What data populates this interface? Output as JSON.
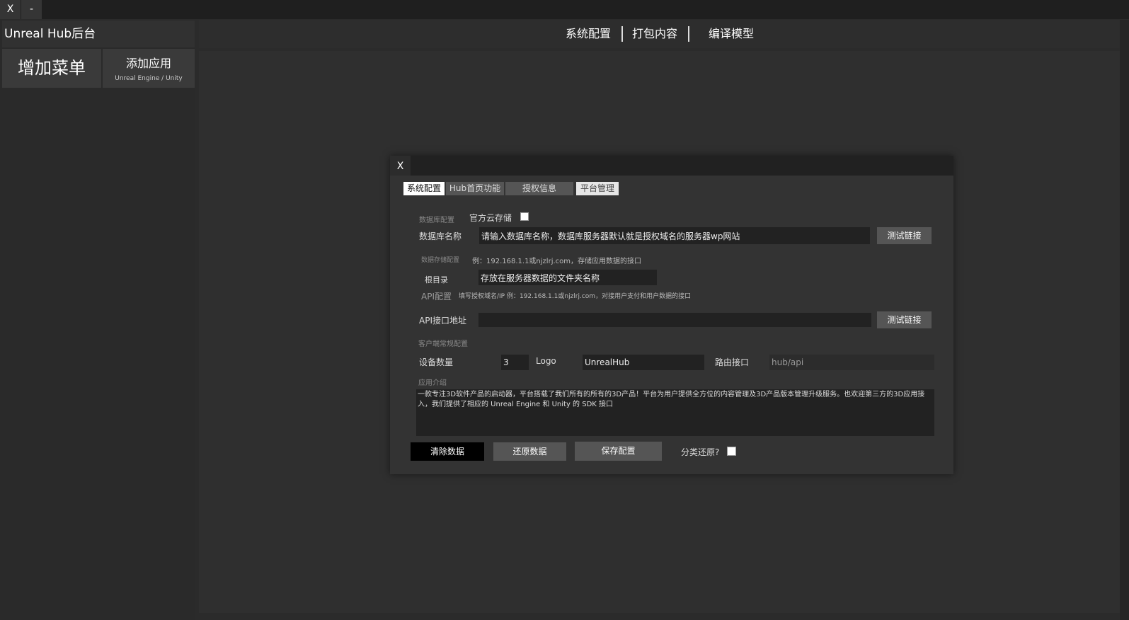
{
  "window": {
    "close_label": "X",
    "minimize_label": "-"
  },
  "sidebar": {
    "title": "Unreal Hub后台",
    "add_menu_label": "增加菜单",
    "add_app_label": "添加应用",
    "add_app_sub": "Unreal Engine / Unity"
  },
  "topnav": {
    "items": [
      "系统配置",
      "打包内容",
      "编译模型"
    ]
  },
  "modal": {
    "close_label": "X",
    "tabs": [
      "系统配置",
      "Hub首页功能",
      "授权信息",
      "平台管理"
    ],
    "db_section": "数据库配置",
    "cloud_label": "官方云存储",
    "db_name_label": "数据库名称",
    "db_name_value": "请输入数据库名称，数据库服务器默认就是授权域名的服务器wp网站",
    "test_link_label": "测试链接",
    "storage_section": "数据存储配置",
    "storage_hint": "例：192.168.1.1或njzlrj.com，存储应用数据的接口",
    "root_label": "根目录",
    "root_value": "存放在服务器数据的文件夹名称",
    "api_section": "API配置",
    "api_hint": "填写授权域名/IP 例：192.168.1.1或njzlrj.com，对接用户支付和用户数据的接口",
    "api_addr_label": "API接口地址",
    "api_addr_value": "",
    "api_test_label": "测试链接",
    "client_section": "客户端常规配置",
    "device_label": "设备数量",
    "device_value": "3",
    "logo_label": "Logo",
    "logo_value": "UnrealHub",
    "route_label": "路由接口",
    "route_value": "hub/api",
    "intro_label": "应用介绍",
    "intro_value": "一款专注3D软件产品的启动器，平台搭载了我们所有的所有的3D产品！平台为用户提供全方位的内容管理及3D产品版本管理升级服务。也欢迎第三方的3D应用接入，我们提供了相应的 Unreal Engine 和 Unity 的 SDK 接口",
    "clear_label": "清除数据",
    "restore_label": "还原数据",
    "save_label": "保存配置",
    "category_restore_label": "分类还原?"
  }
}
